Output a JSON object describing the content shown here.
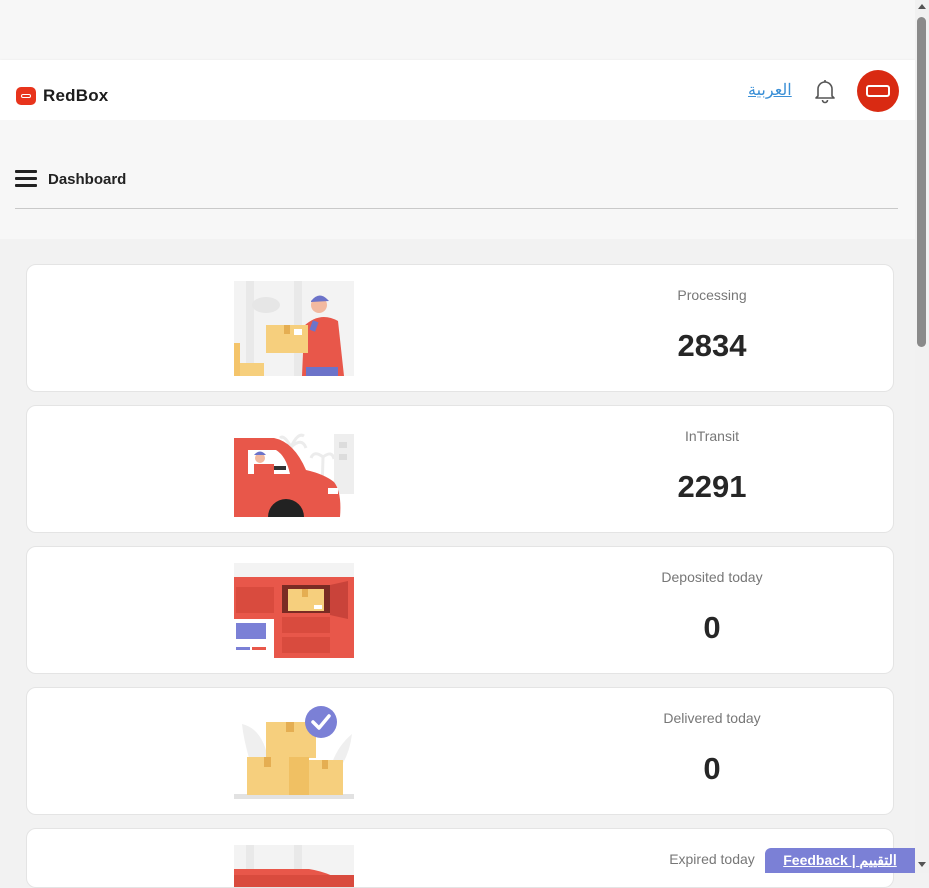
{
  "header": {
    "brand": "RedBox",
    "language_link": "العربية",
    "bell_icon": "bell-icon",
    "avatar_icon": "redbox-avatar-icon"
  },
  "subbar": {
    "menu_icon": "hamburger-menu-icon",
    "title": "Dashboard"
  },
  "colors": {
    "brand_red": "#e8341c",
    "feedback_bg": "#7b80d6",
    "link": "#3a8fd6"
  },
  "stats": [
    {
      "label": "Processing",
      "value": "2834",
      "illustration": "courier-holding-package"
    },
    {
      "label": "InTransit",
      "value": "2291",
      "illustration": "courier-driving-van"
    },
    {
      "label": "Deposited today",
      "value": "0",
      "illustration": "parcel-in-locker"
    },
    {
      "label": "Delivered today",
      "value": "0",
      "illustration": "boxes-with-checkmark"
    },
    {
      "label": "Expired today",
      "value": "",
      "illustration": "expired-locker"
    }
  ],
  "feedback": {
    "label": "Feedback | التقييم"
  }
}
